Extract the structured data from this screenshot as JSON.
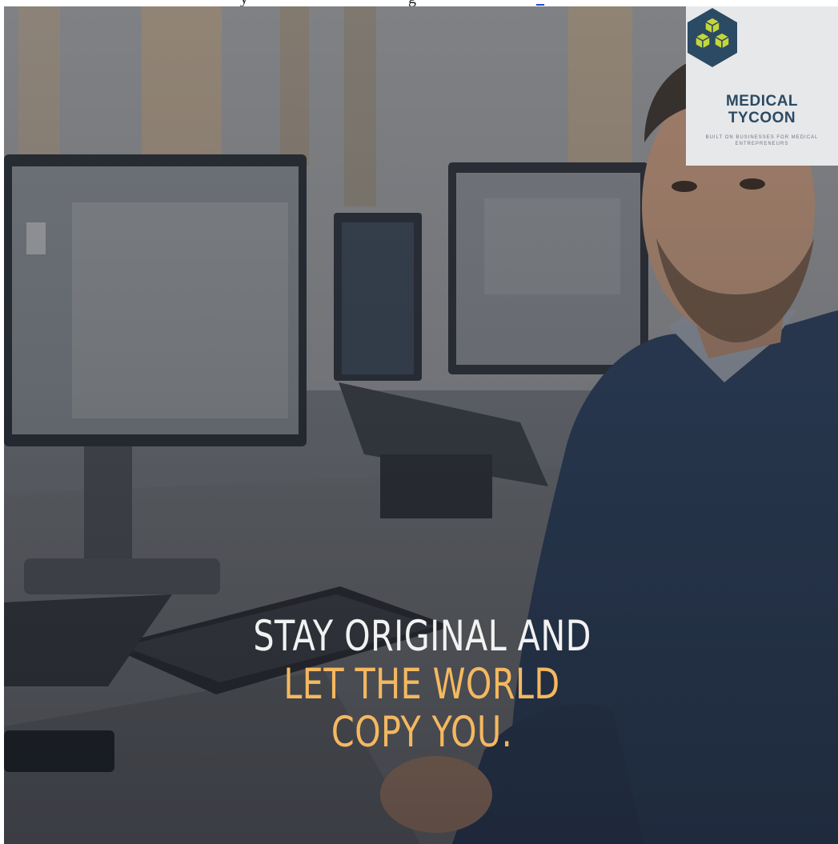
{
  "header": {
    "text_prefix": "y",
    "text_middle": "g",
    "link_text": "_"
  },
  "logo": {
    "icon": "hexagon-cubes-icon",
    "line1": "MEDICAL",
    "line2": "TYCOON",
    "tagline": "BUILT ON BUSINESSES FOR MEDICAL ENTREPRENEURS",
    "colors": {
      "hexagon": "#2b4a63",
      "cubes": "#c5d63a",
      "text": "#2b4a63"
    }
  },
  "quote": {
    "line1": "STAY ORIGINAL AND",
    "line2": "LET THE WORLD",
    "line3": "COPY YOU.",
    "colors": {
      "white": "#f2f2f2",
      "gold": "#f4b860"
    }
  }
}
